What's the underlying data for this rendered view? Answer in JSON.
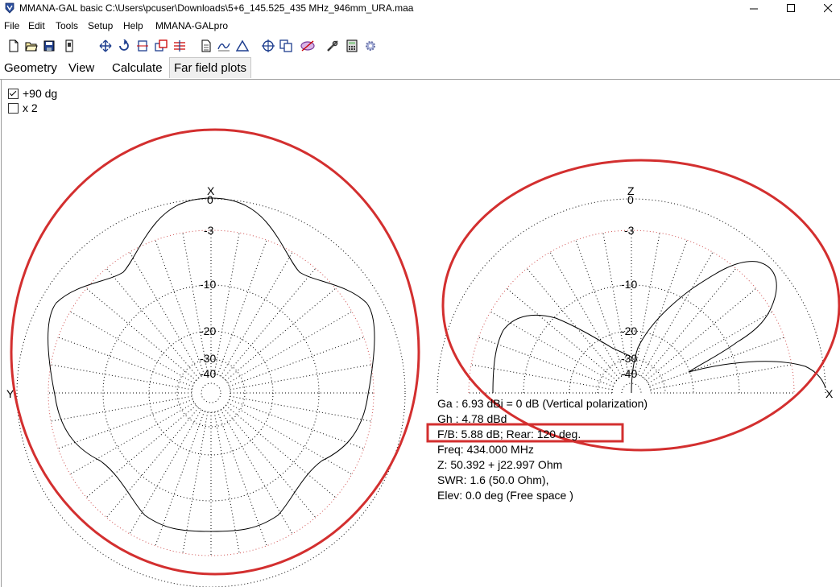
{
  "window": {
    "title": "MMANA-GAL basic C:\\Users\\pcuser\\Downloads\\5+6_145.525_435 MHz_946mm_URA.maa",
    "controls": [
      "minimize",
      "maximize",
      "close"
    ]
  },
  "menu": {
    "items": [
      "File",
      "Edit",
      "Tools",
      "Setup",
      "Help",
      "MMANA-GALpro"
    ]
  },
  "toolbar": {
    "icons": [
      "new-file-icon",
      "open-folder-icon",
      "save-icon",
      "print-icon",
      "move-icon",
      "rotate-icon",
      "stretch-icon",
      "copy-element-icon",
      "wire-edit-icon",
      "document-icon",
      "graph-icon",
      "triangle-icon",
      "target-icon",
      "copy-icon",
      "optimize-icon",
      "tools-icon",
      "calculator-icon",
      "settings-gear-icon"
    ]
  },
  "tabs": [
    {
      "label": "Geometry",
      "active": false
    },
    {
      "label": "View",
      "active": false
    },
    {
      "label": "Calculate",
      "active": false
    },
    {
      "label": "Far field plots",
      "active": true
    }
  ],
  "options": {
    "plus90": {
      "label": "+90 dg",
      "checked": true
    },
    "x2": {
      "label": "x 2",
      "checked": false
    }
  },
  "horizontal_plot": {
    "top_axis": "X",
    "left_axis": "Y",
    "rings": [
      "0",
      "-3",
      "-10",
      "-20",
      "-30",
      "-40"
    ]
  },
  "vertical_plot": {
    "top_axis": "Z",
    "right_axis": "X",
    "rings": [
      "0",
      "-3",
      "-10",
      "-20",
      "-30",
      "-40"
    ]
  },
  "results": {
    "ga": "Ga : 6.93 dBi = 0 dB  (Vertical polarization)",
    "gh": "Gh : 4.78 dBd",
    "fb": "F/B: 5.88 dB; Rear: 120 deg.",
    "freq": "Freq: 434.000 MHz",
    "z": "Z: 50.392 + j22.997 Ohm",
    "swr": "SWR: 1.6 (50.0 Ohm),",
    "elev": "Elev: 0.0 deg (Free space )"
  },
  "colors": {
    "annotation": "#d32f2f",
    "minus3_ring": "#d05050",
    "pattern": "#000000"
  }
}
